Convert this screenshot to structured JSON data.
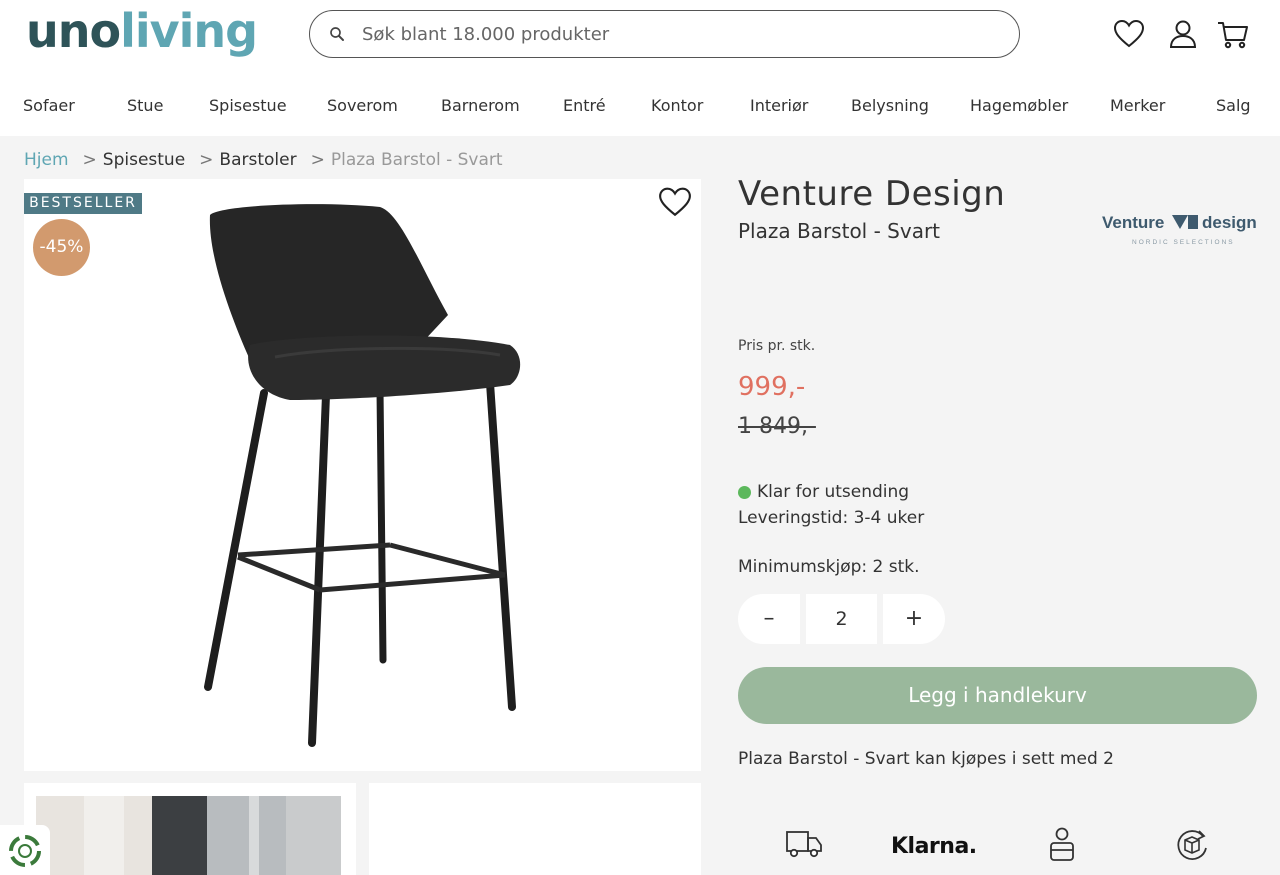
{
  "header": {
    "logo_part1": "uno",
    "logo_part2": "living",
    "search_placeholder": "Søk blant 18.000 produkter",
    "icons": [
      "search-icon",
      "heart-icon",
      "user-icon",
      "cart-icon"
    ]
  },
  "nav": {
    "items": [
      "Sofaer",
      "Stue",
      "Spisestue",
      "Soverom",
      "Barnerom",
      "Entré",
      "Kontor",
      "Interiør",
      "Belysning",
      "Hagemøbler",
      "Merker",
      "Salg"
    ]
  },
  "breadcrumb": {
    "items": [
      "Hjem",
      "Spisestue",
      "Barstoler",
      "Plaza Barstol - Svart"
    ],
    "separator": ">"
  },
  "product": {
    "badge": "BESTSELLER",
    "discount": "-45%",
    "brand": "Venture Design",
    "name": "Plaza Barstol - Svart",
    "brand_logo_text": "Venture design",
    "brand_logo_sub": "NORDIC SELECTIONS",
    "price_label": "Pris pr. stk.",
    "price": "999,-",
    "old_price": "1 849,-",
    "stock_status": "Klar for utsending",
    "delivery": "Leveringstid: 3-4 uker",
    "min_purchase": "Minimumskjøp: 2 stk.",
    "quantity": "2",
    "qty_minus": "–",
    "qty_plus": "+",
    "add_to_cart": "Legg i handlekurv",
    "set_info": "Plaza Barstol - Svart kan kjøpes i sett med 2"
  },
  "features": {
    "klarna": "Klarna."
  },
  "colors": {
    "logo_dark": "#2e5358",
    "logo_light": "#5fa6b3",
    "price_red": "#e07060",
    "cart_button": "#9ab89c",
    "badge_bg": "#4f7a86",
    "discount_bg": "#d29a6e",
    "stock_green": "#5cb85c"
  }
}
